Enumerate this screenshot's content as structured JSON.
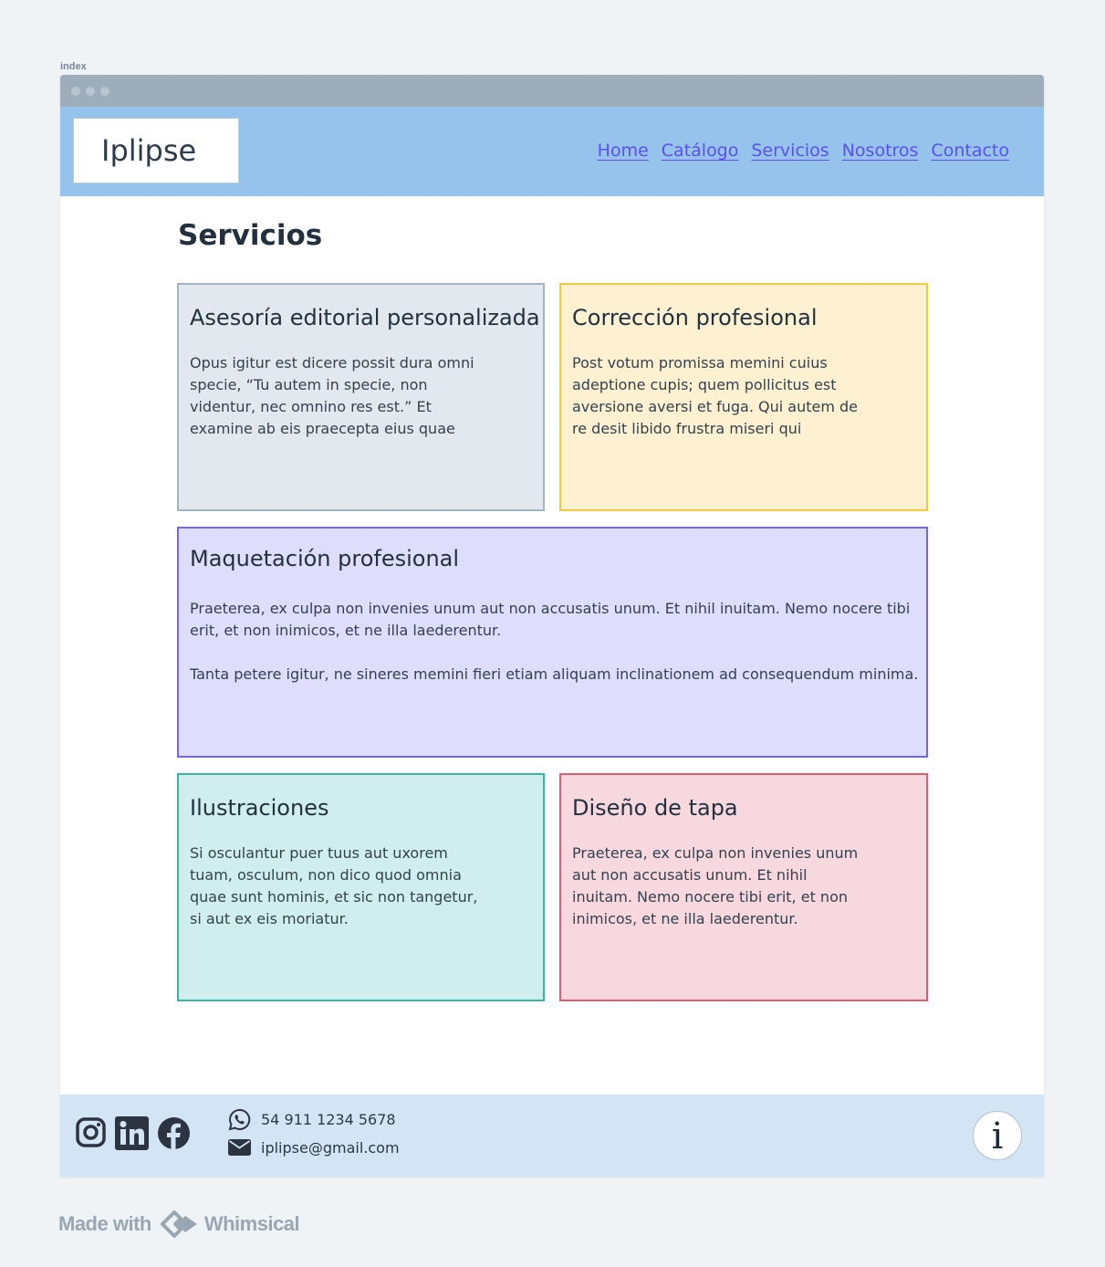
{
  "frame_label": "index",
  "brand": {
    "name": "Iplipse"
  },
  "nav": [
    {
      "label": "Home"
    },
    {
      "label": "Catálogo"
    },
    {
      "label": "Servicios"
    },
    {
      "label": "Nosotros"
    },
    {
      "label": "Contacto"
    }
  ],
  "main": {
    "title": "Servicios",
    "cards": [
      {
        "title": "Asesoría editorial personalizada",
        "lines": [
          "Opus igitur est dicere possit dura omni",
          "specie, “Tu autem in specie, non",
          "videntur, nec omnino res est.” Et",
          "examine ab eis praecepta eius quae"
        ]
      },
      {
        "title": "Corrección profesional",
        "lines": [
          "Post votum promissa memini cuius",
          "adeptione cupis; quem pollicitus est",
          "aversione aversi et fuga. Qui autem de",
          "re desit libido frustra miseri qui"
        ]
      },
      {
        "title": "Maquetación profesional",
        "lines": [
          "Praeterea, ex culpa non invenies unum aut non accusatis unum. Et nihil inuitam. Nemo nocere tibi",
          "erit, et non inimicos, et ne illa laederentur."
        ],
        "lines2": [
          "Tanta petere igitur, ne sineres memini fieri etiam aliquam inclinationem ad consequendum minima."
        ]
      },
      {
        "title": "Ilustraciones",
        "lines": [
          "Si osculantur puer tuus aut uxorem",
          "tuam, osculum, non dico quod omnia",
          "quae sunt hominis, et sic non tangetur,",
          "si aut ex eis moriatur."
        ]
      },
      {
        "title": "Diseño de tapa",
        "lines": [
          "Praeterea, ex culpa non invenies unum",
          "aut non accusatis unum. Et nihil",
          "inuitam. Nemo nocere tibi erit, et non",
          "inimicos, et ne illa laederentur."
        ]
      }
    ]
  },
  "footer": {
    "phone": "54 911 1234 5678",
    "email": "iplipse@gmail.com",
    "info_glyph": "i",
    "social_icons": [
      "instagram-icon",
      "linkedin-icon",
      "facebook-icon"
    ]
  },
  "watermark": {
    "made_with": "Made with",
    "brand": "Whimsical"
  },
  "colors": {
    "header_bg": "#96c3ec",
    "nav_link": "#5b4ff0",
    "card_gray": "#e2e8ed",
    "card_yellow": "#fdf1d2",
    "card_purple": "#deddfc",
    "card_teal": "#d0eeed",
    "card_pink": "#f7d8de",
    "footer_bg": "#d3e4f5"
  }
}
